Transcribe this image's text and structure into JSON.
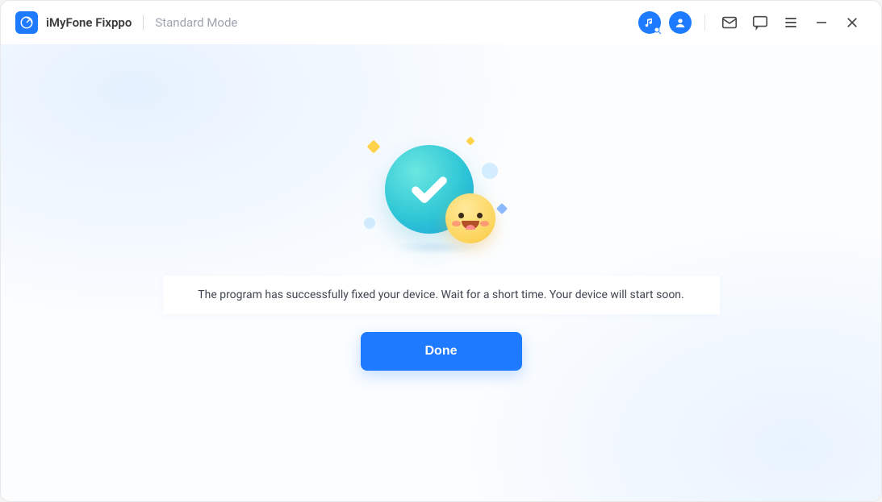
{
  "header": {
    "app_title": "iMyFone Fixppo",
    "mode_label": "Standard Mode",
    "icons": {
      "music": "music-search-icon",
      "profile": "profile-icon",
      "mail": "mail-icon",
      "feedback": "chat-icon",
      "menu": "menu-icon",
      "minimize": "minimize-icon",
      "close": "close-icon"
    }
  },
  "colors": {
    "accent": "#1e7bff"
  },
  "main": {
    "message": "The program has successfully fixed your device. Wait for a short time. Your device will start soon.",
    "done_label": "Done"
  }
}
